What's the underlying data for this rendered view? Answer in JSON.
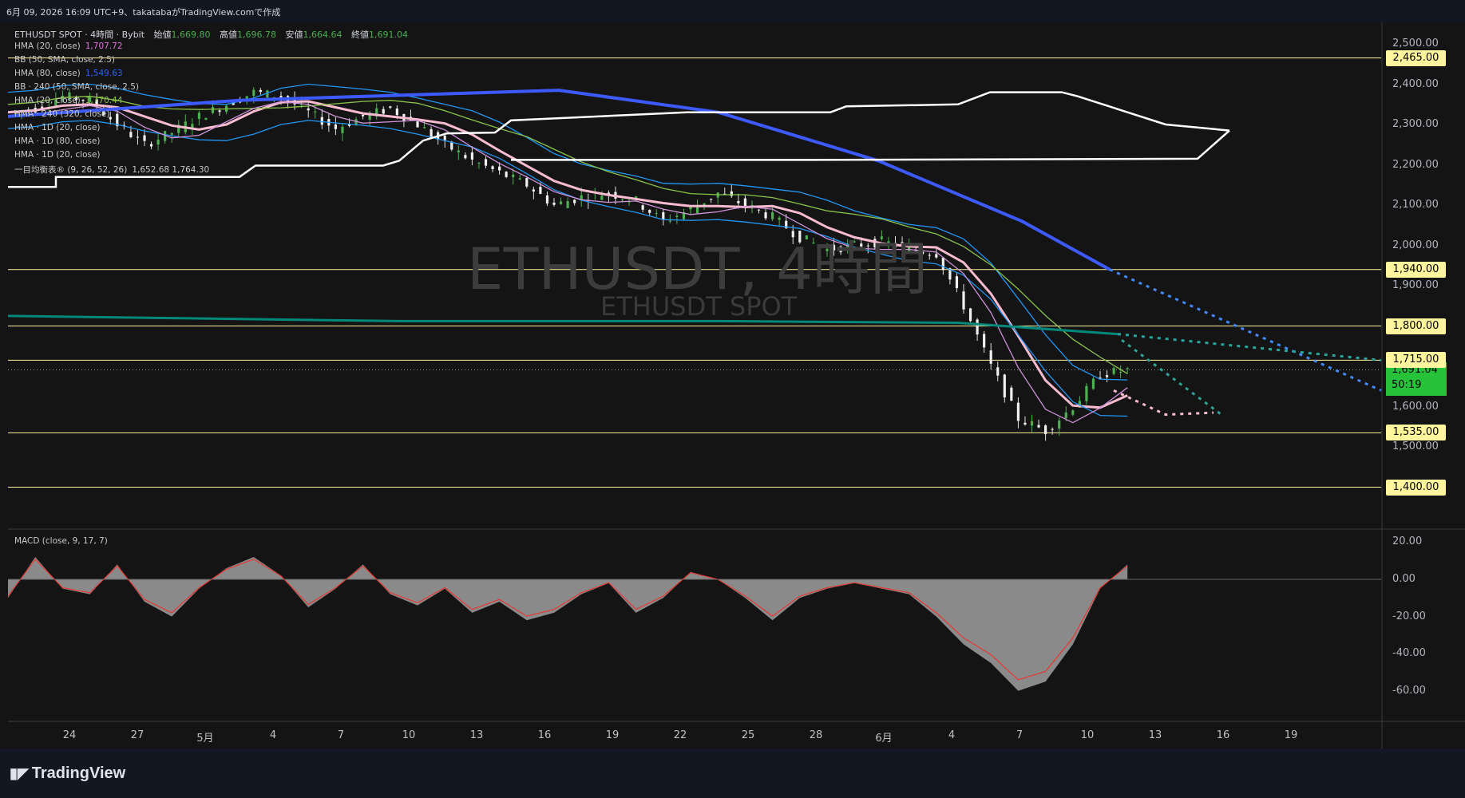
{
  "topbar": {
    "text": "6月 09, 2026 16:09 UTC+9、takatabaがTradingView.comで作成"
  },
  "header": {
    "symbol": "ETHUSDT SPOT · 4時間 · Bybit",
    "open_label": "始値",
    "open": "1,669.80",
    "high_label": "高値",
    "high": "1,696.78",
    "low_label": "安値",
    "low": "1,664.64",
    "close_label": "終値",
    "close": "1,691.04"
  },
  "indicators": [
    {
      "name": "HMA (20, close)",
      "value": "1,707.72",
      "color": "#e26fe0"
    },
    {
      "name": "BB (50, SMA, close, 2.5)",
      "value": "",
      "color": "#c8c8c8"
    },
    {
      "name": "HMA (80, close)",
      "value": "1,549.63",
      "color": "#2962ff"
    },
    {
      "name": "BB · 240 (50, SMA, close, 2.5)",
      "value": "",
      "color": "#c8c8c8"
    },
    {
      "name": "HMA (20, close)",
      "value": "1,770.44",
      "color": "#8bc34a"
    },
    {
      "name": "HMA · 240 (320, close)",
      "value": "",
      "color": "#c8c8c8"
    },
    {
      "name": "HMA · 1D (20, close)",
      "value": "",
      "color": "#c8c8c8"
    },
    {
      "name": "HMA · 1D (80, close)",
      "value": "",
      "color": "#c8c8c8"
    },
    {
      "name": "HMA · 1D (20, close)",
      "value": "",
      "color": "#c8c8c8"
    },
    {
      "name": "一目均衡表® (9, 26, 52, 26)",
      "value": "1,652.68  1,764.30",
      "color": "#c8c8c8"
    }
  ],
  "watermark": {
    "main": "ETHUSDT, 4時間",
    "sub": "ETHUSDT SPOT"
  },
  "current_price": {
    "price": "1,691.04",
    "countdown": "50:19",
    "color": "#26c23a"
  },
  "macd": {
    "title": "MACD (close, 9, 17, 7)"
  },
  "footer": {
    "logo": "TradingView"
  },
  "chart_data": {
    "type": "candlestick",
    "price_axis": {
      "ticks": [
        2500,
        2400,
        2300,
        2200,
        2100,
        2000,
        1900,
        1600,
        1500
      ],
      "tick_labels": [
        "2,500.00",
        "2,400.00",
        "2,300.00",
        "2,200.00",
        "2,100.00",
        "2,000.00",
        "1,900.00",
        "1,600.00",
        "1,500.00"
      ]
    },
    "horizontal_levels": [
      {
        "value": 2465,
        "label": "2,465.00",
        "color": "#fff59d"
      },
      {
        "value": 1940,
        "label": "1,940.00",
        "color": "#fff59d"
      },
      {
        "value": 1800,
        "label": "1,800.00",
        "color": "#fff59d"
      },
      {
        "value": 1715,
        "label": "1,715.00",
        "color": "#fff59d"
      },
      {
        "value": 1535,
        "label": "1,535.00",
        "color": "#fff59d"
      },
      {
        "value": 1400,
        "label": "1,400.00",
        "color": "#fff59d"
      }
    ],
    "x_axis": {
      "labels": [
        "24",
        "27",
        "5月",
        "4",
        "7",
        "10",
        "13",
        "16",
        "19",
        "22",
        "25",
        "28",
        "6月",
        "4",
        "7",
        "10",
        "13",
        "16",
        "19"
      ]
    },
    "price_path": [
      [
        0,
        2330
      ],
      [
        4,
        2340
      ],
      [
        8,
        2370
      ],
      [
        12,
        2360
      ],
      [
        16,
        2300
      ],
      [
        20,
        2250
      ],
      [
        24,
        2280
      ],
      [
        28,
        2320
      ],
      [
        32,
        2350
      ],
      [
        36,
        2380
      ],
      [
        40,
        2370
      ],
      [
        44,
        2330
      ],
      [
        48,
        2290
      ],
      [
        52,
        2320
      ],
      [
        56,
        2340
      ],
      [
        60,
        2300
      ],
      [
        64,
        2250
      ],
      [
        68,
        2210
      ],
      [
        72,
        2180
      ],
      [
        76,
        2150
      ],
      [
        80,
        2100
      ],
      [
        84,
        2120
      ],
      [
        88,
        2130
      ],
      [
        92,
        2110
      ],
      [
        96,
        2060
      ],
      [
        100,
        2090
      ],
      [
        104,
        2130
      ],
      [
        108,
        2100
      ],
      [
        112,
        2070
      ],
      [
        116,
        2020
      ],
      [
        120,
        1990
      ],
      [
        124,
        2000
      ],
      [
        128,
        2010
      ],
      [
        132,
        1990
      ],
      [
        136,
        1980
      ],
      [
        140,
        1850
      ],
      [
        144,
        1700
      ],
      [
        148,
        1570
      ],
      [
        152,
        1540
      ],
      [
        156,
        1600
      ],
      [
        160,
        1680
      ],
      [
        164,
        1691
      ]
    ],
    "macd_path": [
      [
        0,
        -10
      ],
      [
        4,
        12
      ],
      [
        8,
        -5
      ],
      [
        12,
        -8
      ],
      [
        16,
        8
      ],
      [
        20,
        -12
      ],
      [
        24,
        -20
      ],
      [
        28,
        -5
      ],
      [
        32,
        6
      ],
      [
        36,
        12
      ],
      [
        40,
        2
      ],
      [
        44,
        -15
      ],
      [
        48,
        -5
      ],
      [
        52,
        8
      ],
      [
        56,
        -8
      ],
      [
        60,
        -14
      ],
      [
        64,
        -5
      ],
      [
        68,
        -18
      ],
      [
        72,
        -12
      ],
      [
        76,
        -22
      ],
      [
        80,
        -18
      ],
      [
        84,
        -8
      ],
      [
        88,
        -2
      ],
      [
        92,
        -18
      ],
      [
        96,
        -10
      ],
      [
        100,
        4
      ],
      [
        104,
        0
      ],
      [
        108,
        -10
      ],
      [
        112,
        -22
      ],
      [
        116,
        -10
      ],
      [
        120,
        -5
      ],
      [
        124,
        -2
      ],
      [
        128,
        -5
      ],
      [
        132,
        -8
      ],
      [
        136,
        -20
      ],
      [
        140,
        -35
      ],
      [
        144,
        -45
      ],
      [
        148,
        -60
      ],
      [
        152,
        -55
      ],
      [
        156,
        -35
      ],
      [
        160,
        -5
      ],
      [
        164,
        8
      ]
    ],
    "macd_axis": {
      "ticks": [
        20,
        0,
        -20,
        -40,
        -60
      ],
      "tick_labels": [
        "20.00",
        "0.00",
        "-20.00",
        "-40.00",
        "-60.00"
      ]
    }
  }
}
